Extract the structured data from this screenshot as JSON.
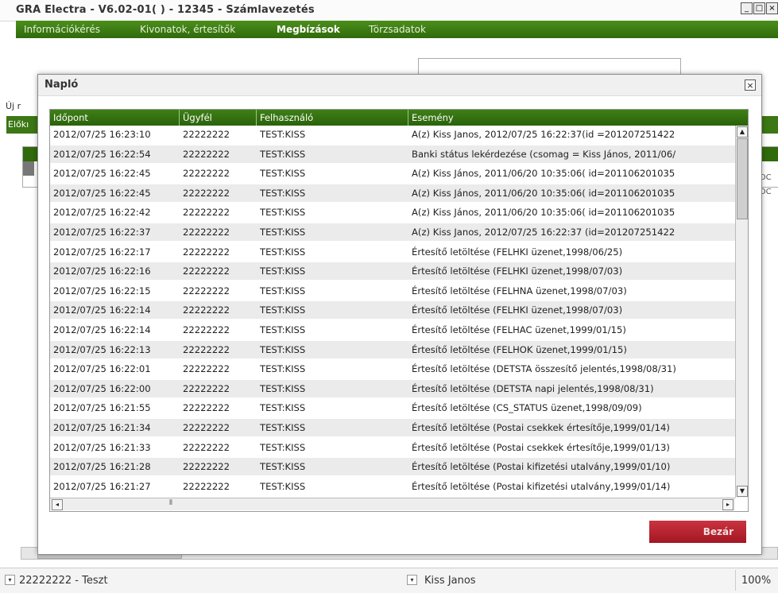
{
  "window": {
    "title": "GRA Electra - V6.02-01( ) - 12345 - Számlavezetés",
    "min": "_",
    "max": "□",
    "close": "×"
  },
  "menu": [
    "Információkérés",
    "Kivonatok, értesítők",
    "Megbízások",
    "Törzsadatok"
  ],
  "menu_active": "Megbízások",
  "bg": {
    "uj_label": "Új r",
    "left_green": "Előkı",
    "num1": "DOC",
    "num2": "DOC"
  },
  "dialog": {
    "title": "Napló",
    "close": "×",
    "columns": [
      "Időpont",
      "Ügyfél",
      "Felhasználó",
      "Esemény"
    ],
    "rows": [
      [
        "2012/07/25 16:23:10",
        "22222222",
        "TEST:KISS",
        "A(z) Kiss Janos, 2012/07/25 16:22:37(id =201207251422"
      ],
      [
        "2012/07/25 16:22:54",
        "22222222",
        "TEST:KISS",
        "Banki státus lekérdezése (csomag = Kiss János, 2011/06/"
      ],
      [
        "2012/07/25 16:22:45",
        "22222222",
        "TEST:KISS",
        "A(z) Kiss János, 2011/06/20 10:35:06( id=201106201035"
      ],
      [
        "2012/07/25 16:22:45",
        "22222222",
        "TEST:KISS",
        "A(z) Kiss János, 2011/06/20 10:35:06( id=201106201035"
      ],
      [
        "2012/07/25 16:22:42",
        "22222222",
        "TEST:KISS",
        "A(z) Kiss János, 2011/06/20 10:35:06( id=201106201035"
      ],
      [
        "2012/07/25 16:22:37",
        "22222222",
        "TEST:KISS",
        "A(z) Kiss Janos, 2012/07/25 16:22:37 (id=201207251422"
      ],
      [
        "2012/07/25 16:22:17",
        "22222222",
        "TEST:KISS",
        "Értesítő letöltése (FELHKI üzenet,1998/06/25)"
      ],
      [
        "2012/07/25 16:22:16",
        "22222222",
        "TEST:KISS",
        "Értesítő letöltése (FELHKI üzenet,1998/07/03)"
      ],
      [
        "2012/07/25 16:22:15",
        "22222222",
        "TEST:KISS",
        "Értesítő letöltése (FELHNA üzenet,1998/07/03)"
      ],
      [
        "2012/07/25 16:22:14",
        "22222222",
        "TEST:KISS",
        "Értesítő letöltése (FELHKI üzenet,1998/07/03)"
      ],
      [
        "2012/07/25 16:22:14",
        "22222222",
        "TEST:KISS",
        "Értesítő letöltése (FELHAC üzenet,1999/01/15)"
      ],
      [
        "2012/07/25 16:22:13",
        "22222222",
        "TEST:KISS",
        "Értesítő letöltése (FELHOK üzenet,1999/01/15)"
      ],
      [
        "2012/07/25 16:22:01",
        "22222222",
        "TEST:KISS",
        "Értesítő letöltése (DETSTA összesítő jelentés,1998/08/31)"
      ],
      [
        "2012/07/25 16:22:00",
        "22222222",
        "TEST:KISS",
        "Értesítő letöltése (DETSTA napi jelentés,1998/08/31)"
      ],
      [
        "2012/07/25 16:21:55",
        "22222222",
        "TEST:KISS",
        "Értesítő letöltése (CS_STATUS üzenet,1998/09/09)"
      ],
      [
        "2012/07/25 16:21:34",
        "22222222",
        "TEST:KISS",
        "Értesítő letöltése (Postai csekkek értesítője,1999/01/14)"
      ],
      [
        "2012/07/25 16:21:33",
        "22222222",
        "TEST:KISS",
        "Értesítő letöltése (Postai csekkek értesítője,1999/01/13)"
      ],
      [
        "2012/07/25 16:21:28",
        "22222222",
        "TEST:KISS",
        "Értesítő letöltése (Postai kifizetési utalvány,1999/01/10)"
      ],
      [
        "2012/07/25 16:21:27",
        "22222222",
        "TEST:KISS",
        "Értesítő letöltése (Postai kifizetési utalvány,1999/01/14)"
      ]
    ],
    "close_button": "Bezár"
  },
  "statusbar": {
    "client": "22222222 - Teszt",
    "user": "Kiss Janos",
    "zoom": "100%"
  },
  "colors": {
    "accent_green": "#2f6a0b",
    "button_red": "#b5202e"
  }
}
